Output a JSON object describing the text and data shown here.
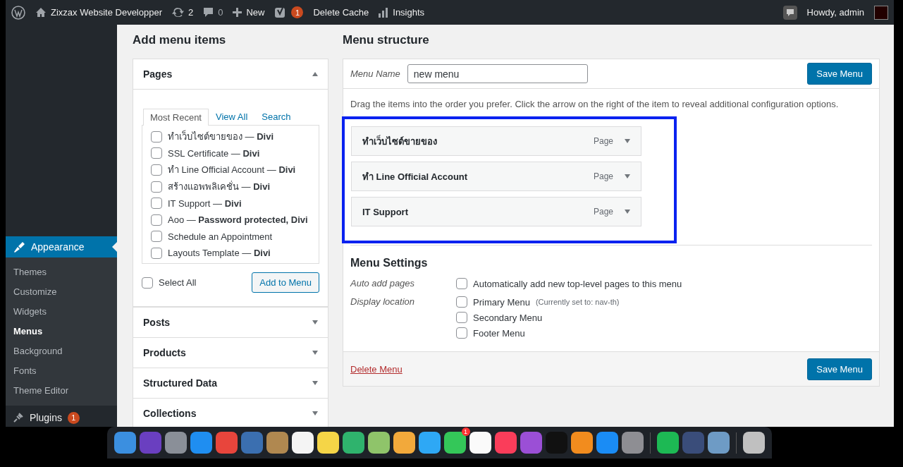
{
  "admin_bar": {
    "site_name": "Zixzax Website Developper",
    "updates": "2",
    "comments": "0",
    "new_label": "New",
    "seo_badge": "1",
    "delete_cache": "Delete Cache",
    "insights": "Insights",
    "greeting": "Howdy, admin"
  },
  "sidebar": {
    "current": {
      "label": "Appearance",
      "selected": true
    },
    "submenu": [
      {
        "label": "Themes",
        "selected": false
      },
      {
        "label": "Customize",
        "selected": false
      },
      {
        "label": "Widgets",
        "selected": false
      },
      {
        "label": "Menus",
        "selected": true
      },
      {
        "label": "Background",
        "selected": false
      },
      {
        "label": "Fonts",
        "selected": false
      },
      {
        "label": "Theme Editor",
        "selected": false
      }
    ],
    "next": {
      "label": "Plugins",
      "badge": "1"
    }
  },
  "add_menu_items": {
    "title": "Add menu items",
    "pages": {
      "title": "Pages",
      "expanded": true,
      "tabs": [
        {
          "label": "Most Recent",
          "selected": true
        },
        {
          "label": "View All",
          "selected": false
        },
        {
          "label": "Search",
          "selected": false
        }
      ],
      "items": [
        {
          "label": "ทำเว็บไซต์ขายของ — **Divi**",
          "checked": false
        },
        {
          "label": "SSL Certificate — **Divi**",
          "checked": false
        },
        {
          "label": "ทำ Line Official Account — **Divi**",
          "checked": false
        },
        {
          "label": "สร้างแอพพลิเคชั่น — **Divi**",
          "checked": false
        },
        {
          "label": "IT Support — **Divi**",
          "checked": false
        },
        {
          "label": "Aoo — **Password protected, Divi**",
          "checked": false
        },
        {
          "label": "Schedule an Appointment",
          "checked": false
        },
        {
          "label": "Layouts Template — **Divi**",
          "checked": false
        }
      ],
      "select_all": {
        "label": "Select All",
        "checked": false
      },
      "add_button": "Add to Menu"
    },
    "sections": [
      {
        "title": "Posts",
        "expanded": false
      },
      {
        "title": "Products",
        "expanded": false
      },
      {
        "title": "Structured Data",
        "expanded": false
      },
      {
        "title": "Collections",
        "expanded": false
      }
    ]
  },
  "menu_structure": {
    "title": "Menu structure",
    "menu_name_label": "Menu Name",
    "menu_name": "new menu",
    "save_button": "Save Menu",
    "instructions": "Drag the items into the order you prefer. Click the arrow on the right of the item to reveal additional configuration options.",
    "items": [
      {
        "title": "ทำเว็บไซต์ขายของ",
        "type": "Page"
      },
      {
        "title": "ทำ Line Official Account",
        "type": "Page"
      },
      {
        "title": "IT Support",
        "type": "Page"
      }
    ],
    "settings": {
      "title": "Menu Settings",
      "auto_add": {
        "label": "Auto add pages",
        "option": "Automatically add new top-level pages to this menu",
        "checked": false
      },
      "display_location": {
        "label": "Display location",
        "options": [
          {
            "label": "Primary Menu",
            "note": "(Currently set to: nav-th)",
            "checked": false
          },
          {
            "label": "Secondary Menu",
            "checked": false
          },
          {
            "label": "Footer Menu",
            "checked": false
          }
        ]
      }
    },
    "delete_link": "Delete Menu",
    "save_button_bottom": "Save Menu"
  },
  "dock": [
    {
      "kind": "app",
      "color": "#3b8fe0"
    },
    {
      "kind": "app",
      "color": "#6a3fc0"
    },
    {
      "kind": "app",
      "color": "#8a8f98"
    },
    {
      "kind": "app",
      "color": "#1f8ef1"
    },
    {
      "kind": "app",
      "color": "#e8453c"
    },
    {
      "kind": "app",
      "color": "#3b6fb0"
    },
    {
      "kind": "app",
      "color": "#b08850"
    },
    {
      "kind": "app",
      "color": "#f4f4f4"
    },
    {
      "kind": "app",
      "color": "#f5d547"
    },
    {
      "kind": "app",
      "color": "#2fb36d"
    },
    {
      "kind": "app",
      "color": "#8fc46a"
    },
    {
      "kind": "app",
      "color": "#f2a93b"
    },
    {
      "kind": "app",
      "color": "#2ea8f5"
    },
    {
      "kind": "app",
      "color": "#34c759",
      "badge": "1"
    },
    {
      "kind": "app",
      "color": "#fafafa"
    },
    {
      "kind": "app",
      "color": "#fa3d5a"
    },
    {
      "kind": "app",
      "color": "#9b4fd6"
    },
    {
      "kind": "app",
      "color": "#111111"
    },
    {
      "kind": "app",
      "color": "#f28c1e"
    },
    {
      "kind": "app",
      "color": "#1a8cf5"
    },
    {
      "kind": "app",
      "color": "#8e8e93"
    },
    {
      "kind": "separator"
    },
    {
      "kind": "app",
      "color": "#1db954"
    },
    {
      "kind": "app",
      "color": "#3a4d7a"
    },
    {
      "kind": "app",
      "color": "#6e9bc5"
    },
    {
      "kind": "separator"
    },
    {
      "kind": "app",
      "color": "#c0c0c0"
    }
  ]
}
